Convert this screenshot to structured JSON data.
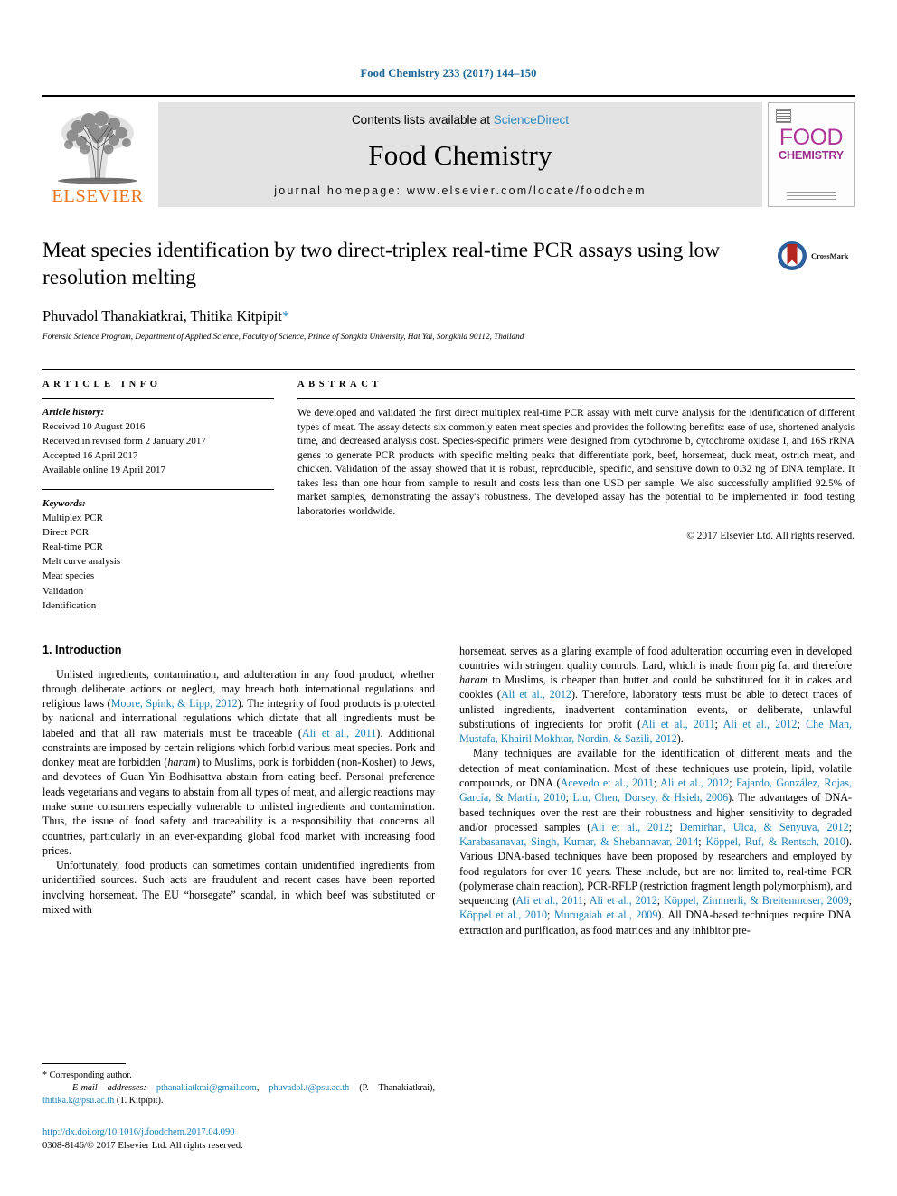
{
  "running_head": "Food Chemistry 233 (2017) 144–150",
  "masthead": {
    "contents_prefix": "Contents lists available at ",
    "sciencedirect": "ScienceDirect",
    "journal_name": "Food Chemistry",
    "homepage": "journal homepage: www.elsevier.com/locate/foodchem",
    "publisher_wordmark": "ELSEVIER",
    "cover_title_top": "FOOD",
    "cover_title_bottom": "CHEMISTRY"
  },
  "article": {
    "title": "Meat species identification by two direct-triplex real-time PCR assays using low resolution melting",
    "authors": "Phuvadol Thanakiatkrai, Thitika Kitpipit",
    "corresponding_marker": "*",
    "affiliation": "Forensic Science Program, Department of Applied Science, Faculty of Science, Prince of Songkla University, Hat Yai, Songkhla 90112, Thailand",
    "crossmark_label": "CrossMark"
  },
  "article_info": {
    "heading": "ARTICLE INFO",
    "history_label": "Article history:",
    "history": [
      "Received 10 August 2016",
      "Received in revised form 2 January 2017",
      "Accepted 16 April 2017",
      "Available online 19 April 2017"
    ],
    "keywords_label": "Keywords:",
    "keywords": [
      "Multiplex PCR",
      "Direct PCR",
      "Real-time PCR",
      "Melt curve analysis",
      "Meat species",
      "Validation",
      "Identification"
    ]
  },
  "abstract": {
    "heading": "ABSTRACT",
    "text": "We developed and validated the first direct multiplex real-time PCR assay with melt curve analysis for the identification of different types of meat. The assay detects six commonly eaten meat species and provides the following benefits: ease of use, shortened analysis time, and decreased analysis cost. Species-specific primers were designed from cytochrome b, cytochrome oxidase I, and 16S rRNA genes to generate PCR products with specific melting peaks that differentiate pork, beef, horsemeat, duck meat, ostrich meat, and chicken. Validation of the assay showed that it is robust, reproducible, specific, and sensitive down to 0.32 ng of DNA template. It takes less than one hour from sample to result and costs less than one USD per sample. We also successfully amplified 92.5% of market samples, demonstrating the assay's robustness. The developed assay has the potential to be implemented in food testing laboratories worldwide.",
    "copyright": "© 2017 Elsevier Ltd. All rights reserved."
  },
  "introduction": {
    "heading": "1. Introduction",
    "left_para_1_a": "Unlisted ingredients, contamination, and adulteration in any food product, whether through deliberate actions or neglect, may breach both international regulations and religious laws (",
    "left_cit_1": "Moore, Spink, & Lipp, 2012",
    "left_para_1_b": "). The integrity of food products is protected by national and international regulations which dictate that all ingredients must be labeled and that all raw materials must be traceable (",
    "left_cit_2": "Ali et al., 2011",
    "left_para_1_c": "). Additional constraints are imposed by certain religions which forbid various meat species. Pork and donkey meat are forbidden (",
    "left_italic_1": "haram",
    "left_para_1_d": ") to Muslims, pork is forbidden (non-Kosher) to Jews, and devotees of Guan Yin Bodhisattva abstain from eating beef. Personal preference leads vegetarians and vegans to abstain from all types of meat, and allergic reactions may make some consumers especially vulnerable to unlisted ingredients and contamination. Thus, the issue of food safety and traceability is a responsibility that concerns all countries, particularly in an ever-expanding global food market with increasing food prices.",
    "left_para_2": "Unfortunately, food products can sometimes contain unidentified ingredients from unidentified sources. Such acts are fraudulent and recent cases have been reported involving horsemeat. The EU “horsegate” scandal, in which beef was substituted or mixed with",
    "right_para_1_a": "horsemeat, serves as a glaring example of food adulteration occurring even in developed countries with stringent quality controls. Lard, which is made from pig fat and therefore ",
    "right_italic_1": "haram",
    "right_para_1_b": " to Muslims, is cheaper than butter and could be substituted for it in cakes and cookies (",
    "right_cit_1": "Ali et al., 2012",
    "right_para_1_c": "). Therefore, laboratory tests must be able to detect traces of unlisted ingredients, inadvertent contamination events, or deliberate, unlawful substitutions of ingredients for profit (",
    "right_cit_2": "Ali et al., 2011",
    "right_sep_1": "; ",
    "right_cit_3": "Ali et al., 2012",
    "right_sep_2": "; ",
    "right_cit_4": "Che Man, Mustafa, Khairil Mokhtar, Nordin, & Sazili, 2012",
    "right_para_1_d": ").",
    "right_para_2_a": "Many techniques are available for the identification of different meats and the detection of meat contamination. Most of these techniques use protein, lipid, volatile compounds, or DNA (",
    "right_cit_5": "Acevedo et al., 2011",
    "right_cit_6": "Ali et al., 2012",
    "right_cit_7": "Fajardo, González, Rojas, García, & Martín, 2010",
    "right_cit_8": "Liu, Chen, Dorsey, & Hsieh, 2006",
    "right_para_2_b": "). The advantages of DNA-based techniques over the rest are their robustness and higher sensitivity to degraded and/or processed samples (",
    "right_cit_9": "Ali et al., 2012",
    "right_cit_10": "Demirhan, Ulca, & Senyuva, 2012",
    "right_cit_11": "Karabasanavar, Singh, Kumar, & Shebannavar, 2014",
    "right_cit_12": "Köppel, Ruf, & Rentsch, 2010",
    "right_para_2_c": "). Various DNA-based techniques have been proposed by researchers and employed by food regulators for over 10 years. These include, but are not limited to, real-time PCR (polymerase chain reaction), PCR-RFLP (restriction fragment length polymorphism), and sequencing (",
    "right_cit_13": "Ali et al., 2011",
    "right_cit_14": "Ali et al., 2012",
    "right_cit_15": "Köppel, Zimmerli, & Breitenmoser, 2009",
    "right_cit_16": "Köppel et al., 2010",
    "right_cit_17": "Murugaiah et al., 2009",
    "right_para_2_d": "). All DNA-based techniques require DNA extraction and purification, as food matrices and any inhibitor pre-"
  },
  "footnote": {
    "corresponding": "* Corresponding author.",
    "email_label": "E-mail addresses:",
    "email_1": "pthanakiatkrai@gmail.com",
    "email_2": "phuvadol.t@psu.ac.th",
    "email_1_owner": " (P. Thanakiatkrai), ",
    "email_3": "thitika.k@psu.ac.th",
    "email_3_owner": " (T. Kitpipit).",
    "doi": "http://dx.doi.org/10.1016/j.foodchem.2017.04.090",
    "issn_line": "0308-8146/© 2017 Elsevier Ltd. All rights reserved."
  },
  "colors": {
    "link_blue": "#1a7fb5",
    "sciencedirect_blue": "#2e8bc0",
    "elsevier_orange": "#e87722",
    "cover_magenta": "#b0379a",
    "masthead_gray": "#e3e3e3"
  }
}
